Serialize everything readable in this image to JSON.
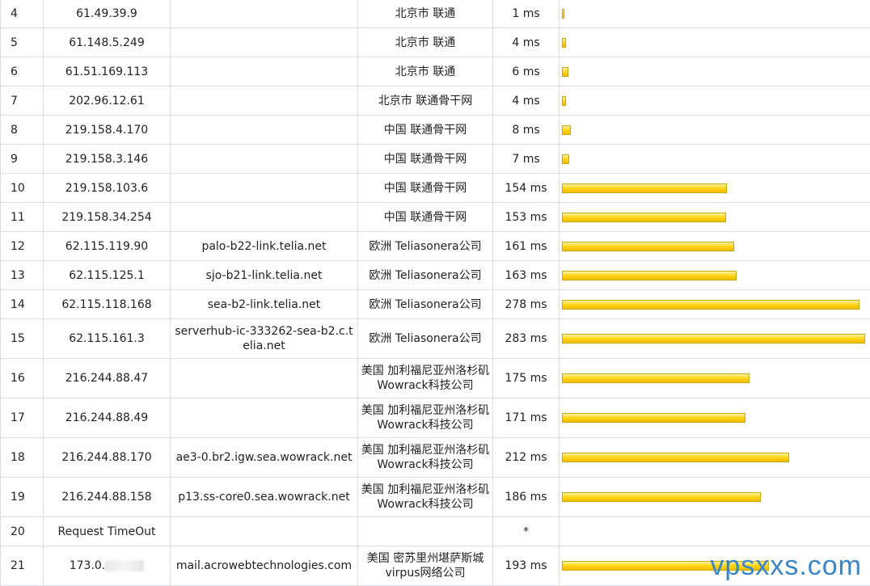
{
  "rows": [
    {
      "hop": "4",
      "ip": "61.49.39.9",
      "host": "",
      "loc": "北京市 联通",
      "rtt": "1 ms",
      "ms": 1
    },
    {
      "hop": "5",
      "ip": "61.148.5.249",
      "host": "",
      "loc": "北京市 联通",
      "rtt": "4 ms",
      "ms": 4
    },
    {
      "hop": "6",
      "ip": "61.51.169.113",
      "host": "",
      "loc": "北京市 联通",
      "rtt": "6 ms",
      "ms": 6
    },
    {
      "hop": "7",
      "ip": "202.96.12.61",
      "host": "",
      "loc": "北京市 联通骨干网",
      "rtt": "4 ms",
      "ms": 4
    },
    {
      "hop": "8",
      "ip": "219.158.4.170",
      "host": "",
      "loc": "中国 联通骨干网",
      "rtt": "8 ms",
      "ms": 8
    },
    {
      "hop": "9",
      "ip": "219.158.3.146",
      "host": "",
      "loc": "中国 联通骨干网",
      "rtt": "7 ms",
      "ms": 7
    },
    {
      "hop": "10",
      "ip": "219.158.103.6",
      "host": "",
      "loc": "中国 联通骨干网",
      "rtt": "154 ms",
      "ms": 154
    },
    {
      "hop": "11",
      "ip": "219.158.34.254",
      "host": "",
      "loc": "中国 联通骨干网",
      "rtt": "153 ms",
      "ms": 153
    },
    {
      "hop": "12",
      "ip": "62.115.119.90",
      "host": "palo-b22-link.telia.net",
      "loc": "欧洲 Teliasonera公司",
      "rtt": "161 ms",
      "ms": 161
    },
    {
      "hop": "13",
      "ip": "62.115.125.1",
      "host": "sjo-b21-link.telia.net",
      "loc": "欧洲 Teliasonera公司",
      "rtt": "163 ms",
      "ms": 163
    },
    {
      "hop": "14",
      "ip": "62.115.118.168",
      "host": "sea-b2-link.telia.net",
      "loc": "欧洲 Teliasonera公司",
      "rtt": "278 ms",
      "ms": 278
    },
    {
      "hop": "15",
      "ip": "62.115.161.3",
      "host": "serverhub-ic-333262-sea-b2.c.telia.net",
      "loc": "欧洲 Teliasonera公司",
      "rtt": "283 ms",
      "ms": 283,
      "tall": true
    },
    {
      "hop": "16",
      "ip": "216.244.88.47",
      "host": "",
      "loc": "美国 加利福尼亚州洛杉矶Wowrack科技公司",
      "rtt": "175 ms",
      "ms": 175,
      "tall": true
    },
    {
      "hop": "17",
      "ip": "216.244.88.49",
      "host": "",
      "loc": "美国 加利福尼亚州洛杉矶Wowrack科技公司",
      "rtt": "171 ms",
      "ms": 171,
      "tall": true
    },
    {
      "hop": "18",
      "ip": "216.244.88.170",
      "host": "ae3-0.br2.igw.sea.wowrack.net",
      "loc": "美国 加利福尼亚州洛杉矶Wowrack科技公司",
      "rtt": "212 ms",
      "ms": 212,
      "tall": true
    },
    {
      "hop": "19",
      "ip": "216.244.88.158",
      "host": "p13.ss-core0.sea.wowrack.net",
      "loc": "美国 加利福尼亚州洛杉矶Wowrack科技公司",
      "rtt": "186 ms",
      "ms": 186,
      "tall": true
    },
    {
      "hop": "20",
      "ip": "Request TimeOut",
      "host": "",
      "loc": "",
      "rtt": "*",
      "ms": 0
    },
    {
      "hop": "21",
      "ip": "173.0.",
      "host": "mail.acrowebtechnologies.com",
      "loc": "美国 密苏里州堪萨斯城virpus网络公司",
      "rtt": "193 ms",
      "ms": 193,
      "tall": true,
      "masked": true
    }
  ],
  "bar_scale_max_ms": 283,
  "bar_color": "#ffd81a",
  "watermark": "vpsxxs.com"
}
